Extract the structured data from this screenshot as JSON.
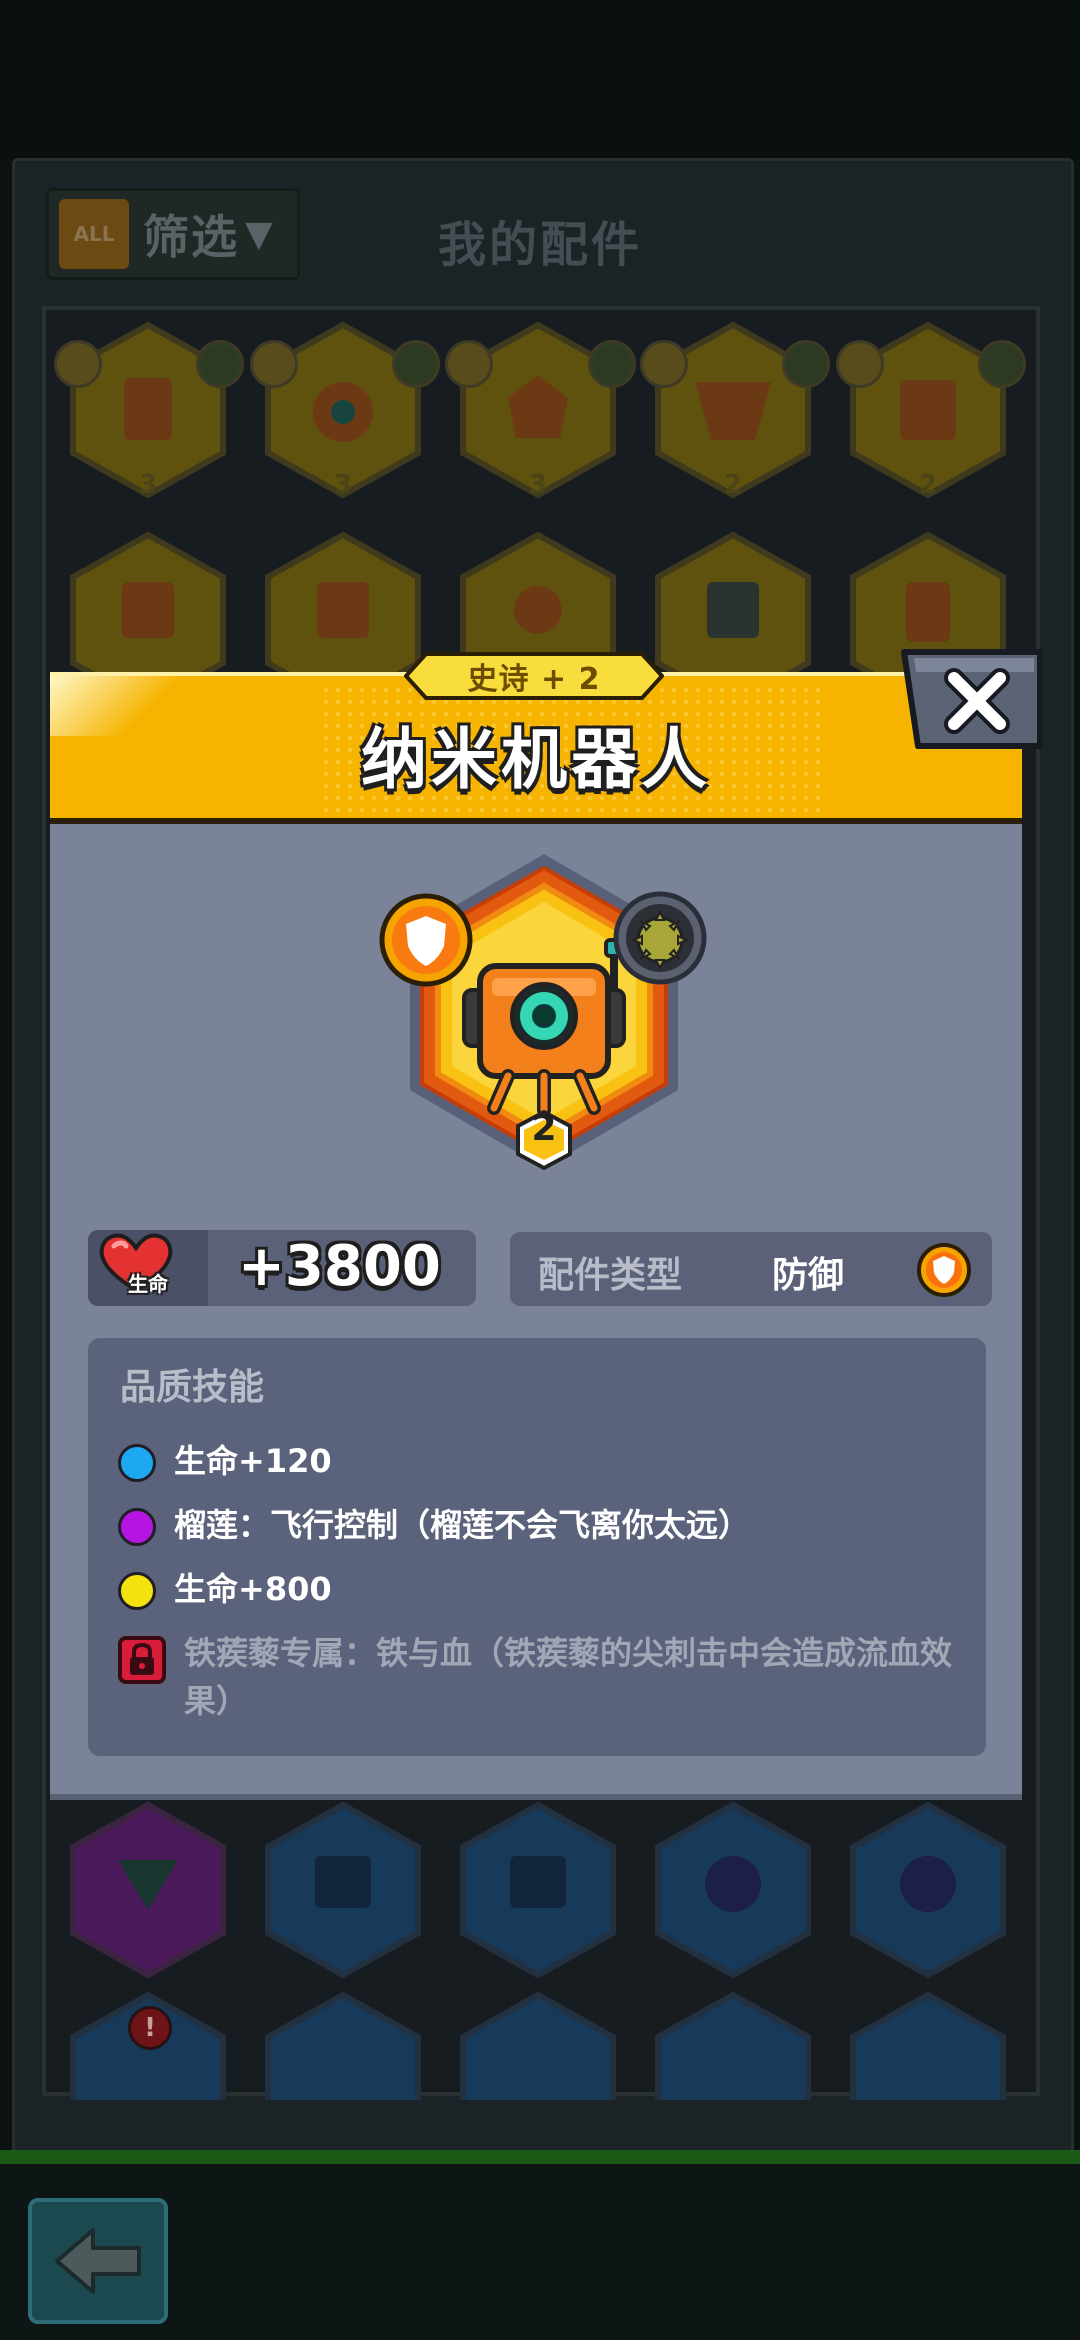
{
  "background": {
    "filter": {
      "all_label": "ALL",
      "label": "筛选",
      "arrow": "▼"
    },
    "title": "我的配件",
    "tiles_row1_levels": [
      "3",
      "3",
      "3",
      "2",
      "2"
    ]
  },
  "modal": {
    "rarity": "史诗 + 2",
    "name": "纳米机器人",
    "close_icon": "close-x-icon",
    "level": "2",
    "stats": {
      "hp_icon_label": "生命",
      "hp_value": "+3800",
      "type_label": "配件类型",
      "type_value": "防御"
    },
    "skills": {
      "title": "品质技能",
      "items": [
        {
          "color": "#1ea8f2",
          "text": "生命+120"
        },
        {
          "color": "#b515e0",
          "text": "榴莲：飞行控制（榴莲不会飞离你太远）"
        },
        {
          "color": "#f4e20e",
          "text": "生命+800"
        }
      ],
      "locked": {
        "text": "铁蒺藜专属：铁与血（铁蒺藜的尖刺击中会造成流血效果）"
      }
    }
  },
  "colors": {
    "header_yellow": "#f6b400",
    "panel_gray": "#7a8398",
    "epic_purple": "#b515e0"
  }
}
